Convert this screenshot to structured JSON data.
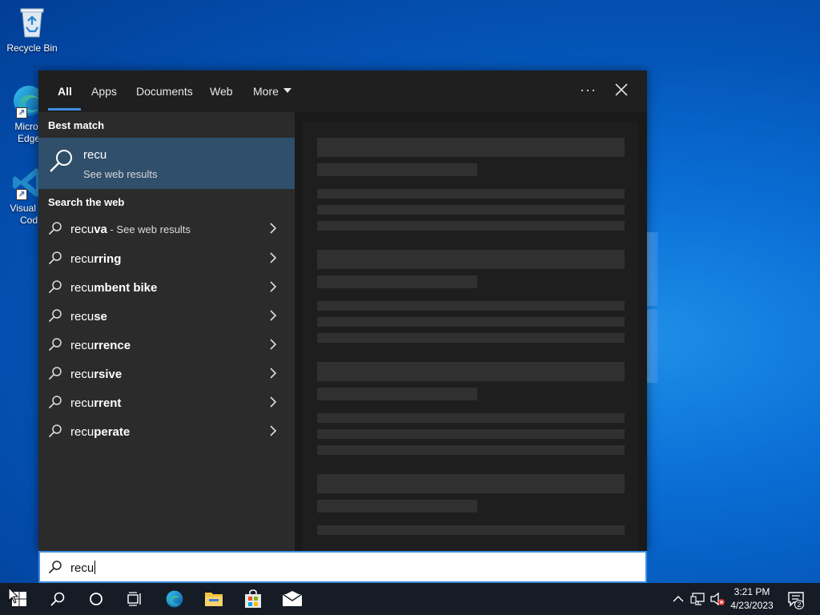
{
  "desktop": {
    "icons": [
      {
        "label": "Recycle Bin"
      },
      {
        "label": "Microsoft Edge",
        "visible_label": "Micros\nEdge"
      },
      {
        "label": "Visual Studio Code",
        "visible_label": "Visual St\nCod"
      }
    ]
  },
  "tabs": {
    "all": "All",
    "apps": "Apps",
    "documents": "Documents",
    "web": "Web",
    "more": "More"
  },
  "menu": {
    "more_options": "···"
  },
  "best_match": {
    "header": "Best match",
    "title": "recu",
    "subtitle": "See web results"
  },
  "search_web": {
    "header": "Search the web",
    "suggestions": [
      {
        "typed": "recu",
        "rest": "va",
        "note": " - See web results"
      },
      {
        "typed": "recu",
        "rest": "rring",
        "note": ""
      },
      {
        "typed": "recu",
        "rest": "mbent bike",
        "note": ""
      },
      {
        "typed": "recu",
        "rest": "se",
        "note": ""
      },
      {
        "typed": "recu",
        "rest": "rrence",
        "note": ""
      },
      {
        "typed": "recu",
        "rest": "rsive",
        "note": ""
      },
      {
        "typed": "recu",
        "rest": "rrent",
        "note": ""
      },
      {
        "typed": "recu",
        "rest": "perate",
        "note": ""
      }
    ]
  },
  "searchbox": {
    "value": "recu"
  },
  "taskbar": {
    "time": "3:21 PM",
    "date": "4/23/2023",
    "notification_count": "2"
  },
  "colors": {
    "accent": "#3d8fe0",
    "best_match_bg": "#2f4f6a",
    "panel_left": "#2b2b2b",
    "panel_right": "#1a1a1a",
    "taskbar": "#151c26"
  }
}
